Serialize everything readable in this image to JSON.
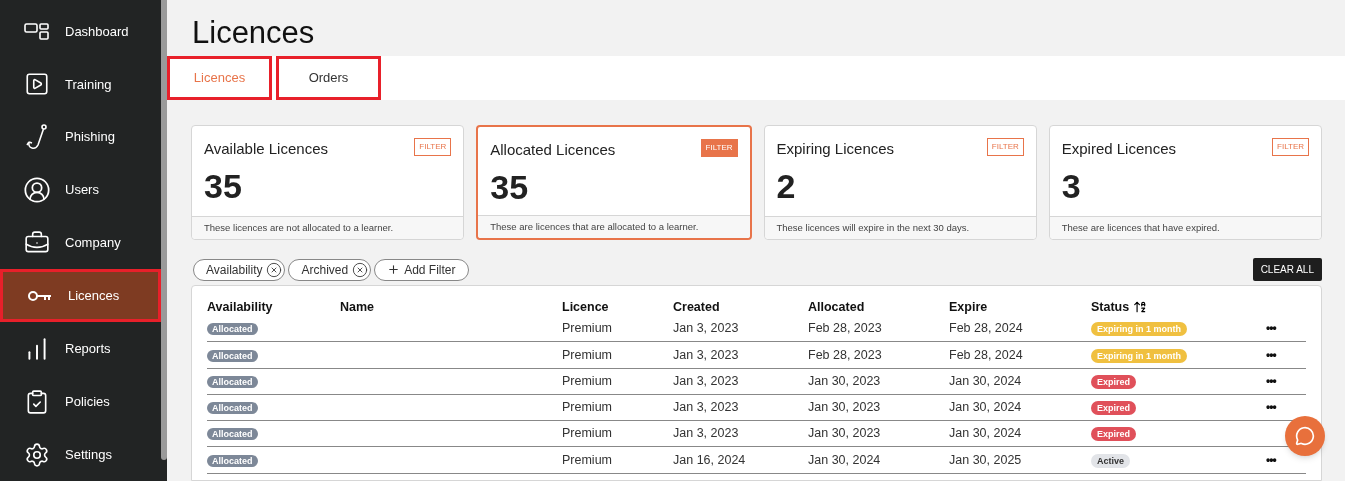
{
  "sidebar": {
    "items": [
      {
        "label": "Dashboard",
        "selected": false,
        "highlighted": false
      },
      {
        "label": "Training",
        "selected": false,
        "highlighted": false
      },
      {
        "label": "Phishing",
        "selected": false,
        "highlighted": false
      },
      {
        "label": "Users",
        "selected": false,
        "highlighted": false
      },
      {
        "label": "Company",
        "selected": false,
        "highlighted": false
      },
      {
        "label": "Licences",
        "selected": true,
        "highlighted": true
      },
      {
        "label": "Reports",
        "selected": false,
        "highlighted": false
      },
      {
        "label": "Policies",
        "selected": false,
        "highlighted": false
      },
      {
        "label": "Settings",
        "selected": false,
        "highlighted": false
      }
    ]
  },
  "page_title": "Licences",
  "tabs": [
    {
      "label": "Licences",
      "selected": true,
      "highlighted": true
    },
    {
      "label": "Orders",
      "selected": false,
      "highlighted": true
    }
  ],
  "cards": [
    {
      "title": "Available Licences",
      "filter": "FILTER",
      "selected": false,
      "count": "35",
      "note": "These licences are not allocated to a learner."
    },
    {
      "title": "Allocated Licences",
      "filter": "FILTER",
      "selected": true,
      "count": "35",
      "note": "These are licences that are allocated to a learner."
    },
    {
      "title": "Expiring Licences",
      "filter": "FILTER",
      "selected": false,
      "count": "2",
      "note": "These licences will expire in the next 30 days."
    },
    {
      "title": "Expired Licences",
      "filter": "FILTER",
      "selected": false,
      "count": "3",
      "note": "These are licences that have expired."
    }
  ],
  "filters": [
    {
      "label": "Availability"
    },
    {
      "label": "Archived"
    }
  ],
  "add_filter": "Add Filter",
  "clear_all": "CLEAR ALL",
  "table": {
    "columns": [
      "Availability",
      "Name",
      "Licence",
      "Created",
      "Allocated",
      "Expire",
      "Status"
    ],
    "rows": [
      {
        "availability": "Allocated",
        "licence": "Premium",
        "created": "Jan 3, 2023",
        "allocated": "Feb 28, 2023",
        "expire": "Feb 28, 2024",
        "status": {
          "label": "Expiring in 1 month",
          "kind": "expiring"
        },
        "actions": "•••"
      },
      {
        "availability": "Allocated",
        "licence": "Premium",
        "created": "Jan 3, 2023",
        "allocated": "Feb 28, 2023",
        "expire": "Feb 28, 2024",
        "status": {
          "label": "Expiring in 1 month",
          "kind": "expiring"
        },
        "actions": "•••"
      },
      {
        "availability": "Allocated",
        "licence": "Premium",
        "created": "Jan 3, 2023",
        "allocated": "Jan 30, 2023",
        "expire": "Jan 30, 2024",
        "status": {
          "label": "Expired",
          "kind": "expired"
        },
        "actions": "•••"
      },
      {
        "availability": "Allocated",
        "licence": "Premium",
        "created": "Jan 3, 2023",
        "allocated": "Jan 30, 2023",
        "expire": "Jan 30, 2024",
        "status": {
          "label": "Expired",
          "kind": "expired"
        },
        "actions": "•••"
      },
      {
        "availability": "Allocated",
        "licence": "Premium",
        "created": "Jan 3, 2023",
        "allocated": "Jan 30, 2023",
        "expire": "Jan 30, 2024",
        "status": {
          "label": "Expired",
          "kind": "expired"
        }
      },
      {
        "availability": "Allocated",
        "licence": "Premium",
        "created": "Jan 16, 2024",
        "allocated": "Jan 30, 2024",
        "expire": "Jan 30, 2025",
        "status": {
          "label": "Active",
          "kind": "active"
        },
        "actions": "•••"
      }
    ]
  }
}
